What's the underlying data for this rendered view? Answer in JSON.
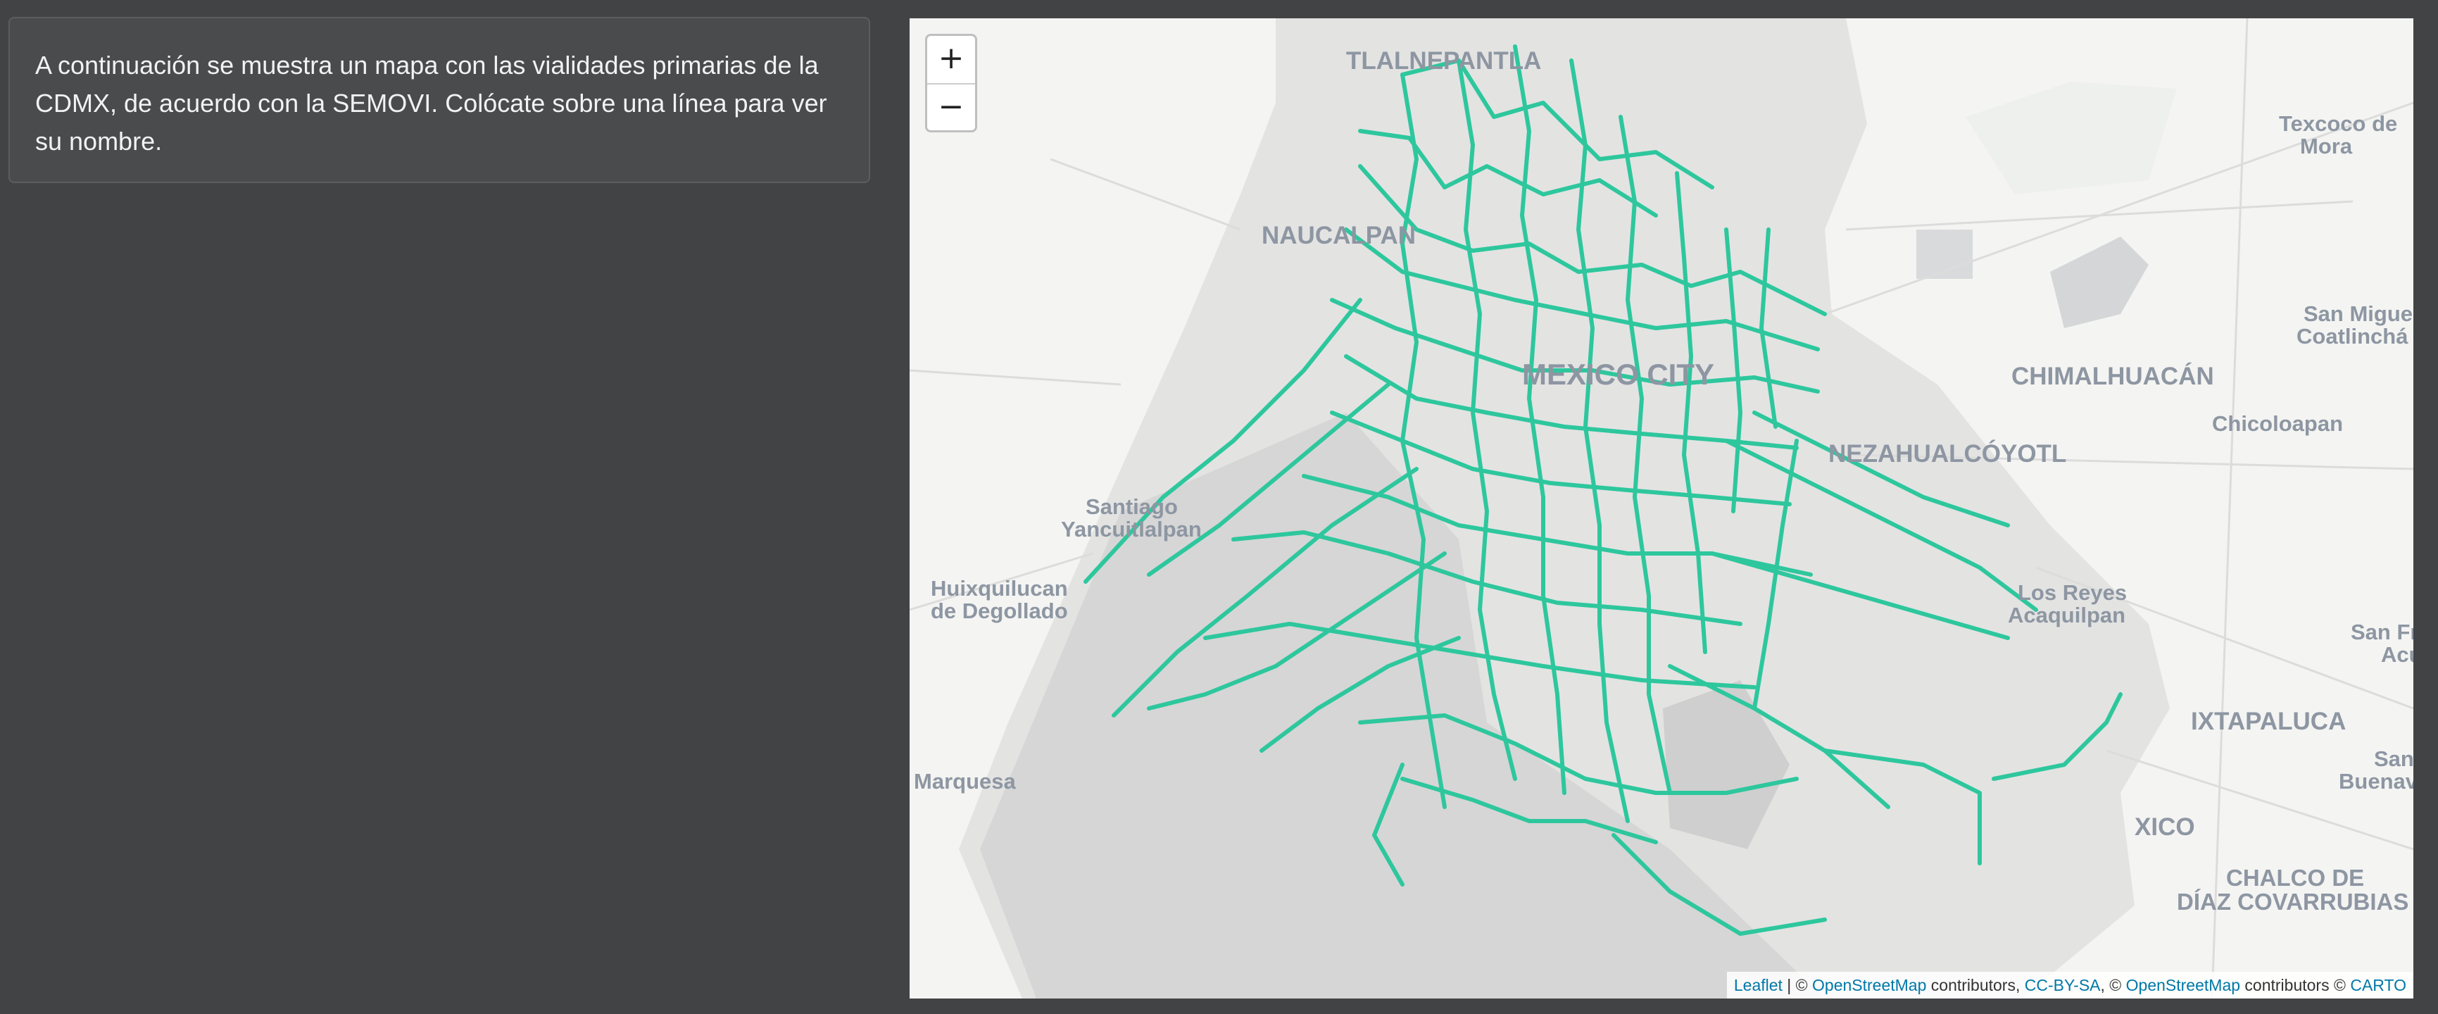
{
  "intro": {
    "line1": "A continuación se muestra un mapa con las vialidades primarias de la",
    "line2": "CDMX, de acuerdo con la SEMOVI. Colócate sobre una línea para ver",
    "line3": "su nombre."
  },
  "map": {
    "zoom_in": "+",
    "zoom_out": "−",
    "road_color": "#2ec79d",
    "labels": {
      "tlalnepantla": "TLALNEPANTLA",
      "naucalpan": "NAUCALPAN",
      "mexico_city": "MEXICO CITY",
      "chimalhuacan": "CHIMALHUACÁN",
      "nezahualcoyotl": "NEZAHUALCÓYOTL",
      "texcoco_1": "Texcoco de",
      "texcoco_2": "Mora",
      "san_miguel_1": "San Migue",
      "san_miguel_2": "Coatlinchá",
      "chicoloapan": "Chicoloapan",
      "santiago_1": "Santiago",
      "santiago_2": "Yancuitlalpan",
      "huixquilucan_1": "Huixquilucan",
      "huixquilucan_2": "de Degollado",
      "los_reyes_1": "Los Reyes",
      "los_reyes_2": "Acaquilpan",
      "san_fr_1": "San Fr",
      "san_fr_2": "Acu",
      "ixtapaluca": "IXTAPALUCA",
      "san_bu_1": "San",
      "san_bu_2": "Buenave",
      "marquesa": "Marquesa",
      "xico": "XICO",
      "chalco_1": "CHALCO DE",
      "chalco_2": "DÍAZ COVARRUBIAS"
    },
    "attribution": {
      "leaflet": "Leaflet",
      "sep1": " | © ",
      "osm1": "OpenStreetMap",
      "contributors1": " contributors, ",
      "ccbysa": "CC-BY-SA",
      "sep2": ", © ",
      "osm2": "OpenStreetMap",
      "contributors2": " contributors © ",
      "carto": "CARTO"
    }
  }
}
